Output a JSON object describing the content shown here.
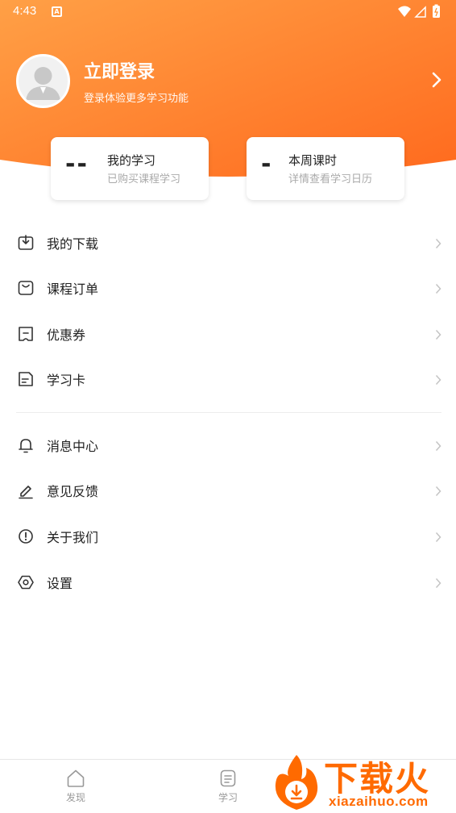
{
  "status_bar": {
    "time": "4:43",
    "notification_icon": "a-badge-icon",
    "icons": [
      "wifi-icon",
      "signal-icon",
      "battery-icon"
    ]
  },
  "profile": {
    "login_title": "立即登录",
    "login_subtitle": "登录体验更多学习功能",
    "avatar_icon": "default-avatar-icon"
  },
  "stats": [
    {
      "value": "--",
      "title": "我的学习",
      "subtitle": "已购买课程学习"
    },
    {
      "value": "-",
      "title": "本周课时",
      "subtitle": "详情查看学习日历"
    }
  ],
  "menu_group_1": [
    {
      "label": "我的下载",
      "icon": "download-icon"
    },
    {
      "label": "课程订单",
      "icon": "shopping-bag-icon"
    },
    {
      "label": "优惠券",
      "icon": "coupon-icon"
    },
    {
      "label": "学习卡",
      "icon": "study-card-icon"
    }
  ],
  "menu_group_2": [
    {
      "label": "消息中心",
      "icon": "bell-icon"
    },
    {
      "label": "意见反馈",
      "icon": "edit-icon"
    },
    {
      "label": "关于我们",
      "icon": "info-icon"
    },
    {
      "label": "设置",
      "icon": "settings-icon"
    }
  ],
  "bottom_nav": [
    {
      "label": "发现",
      "icon": "home-icon"
    },
    {
      "label": "学习",
      "icon": "notes-icon"
    }
  ],
  "watermark": {
    "text": "下载火",
    "url": "xiazaihuo.com"
  },
  "colors": {
    "header_start": "#ff9a3c",
    "header_end": "#ff6a1a",
    "accent": "#ff6a00",
    "text_primary": "#222222",
    "text_secondary": "#aaaaaa"
  }
}
